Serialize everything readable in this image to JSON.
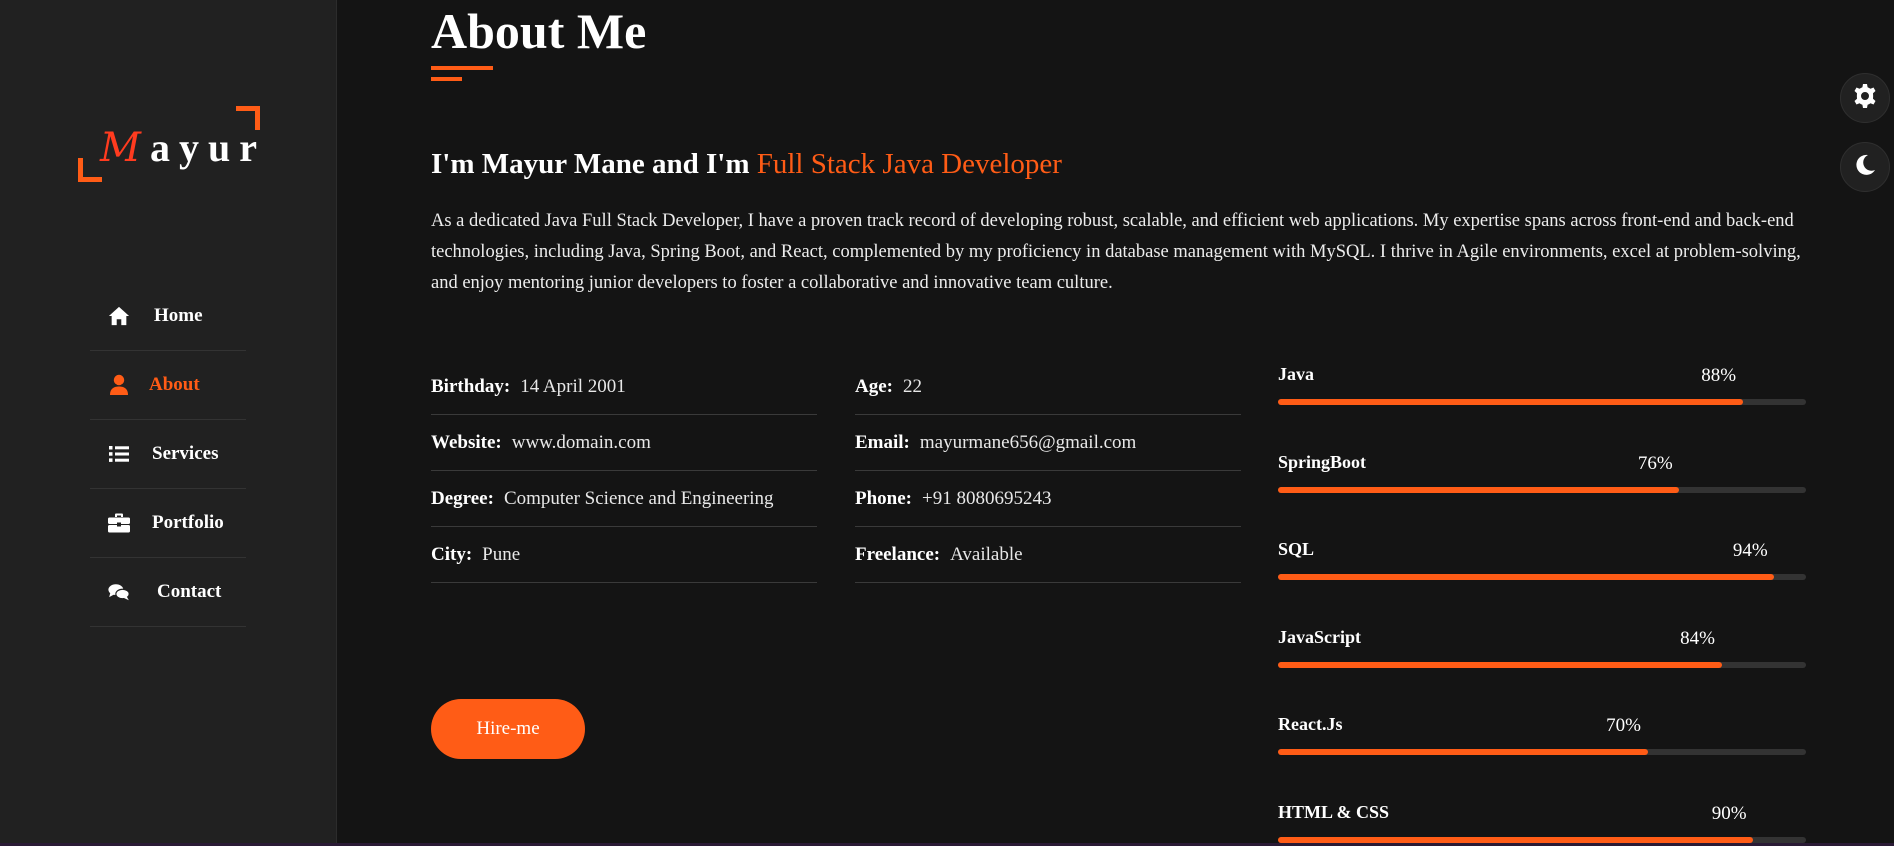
{
  "sidebar": {
    "logo_initial": "M",
    "logo_rest": "ayur",
    "items": [
      {
        "label": "Home",
        "icon": "home-icon",
        "active": false
      },
      {
        "label": "About",
        "icon": "user-icon",
        "active": true
      },
      {
        "label": "Services",
        "icon": "list-icon",
        "active": false
      },
      {
        "label": "Portfolio",
        "icon": "briefcase-icon",
        "active": false
      },
      {
        "label": "Contact",
        "icon": "chat-icon",
        "active": false
      }
    ]
  },
  "about": {
    "title": "About Me",
    "headline_prefix": "I'm Mayur Mane and I'm ",
    "headline_role": "Full Stack Java Developer",
    "intro": "As a dedicated Java Full Stack Developer, I have a proven track record of developing robust, scalable, and efficient web applications. My expertise spans across front-end and back-end technologies, including Java, Spring Boot, and React, complemented by my proficiency in database management with MySQL. I thrive in Agile environments, excel at problem-solving, and enjoy mentoring junior developers to foster a collaborative and innovative team culture.",
    "info_left": [
      {
        "key": "Birthday:",
        "value": "14 April 2001"
      },
      {
        "key": "Website:",
        "value": "www.domain.com"
      },
      {
        "key": "Degree:",
        "value": "Computer Science and Engineering"
      },
      {
        "key": "City:",
        "value": "Pune"
      }
    ],
    "info_right": [
      {
        "key": "Age:",
        "value": "22"
      },
      {
        "key": "Email:",
        "value": "mayurmane656@gmail.com"
      },
      {
        "key": "Phone:",
        "value": "+91 8080695243"
      },
      {
        "key": "Freelance:",
        "value": "Available"
      }
    ],
    "hire_label": "Hire-me",
    "skills": [
      {
        "name": "Java",
        "percent_label": "88%",
        "level": 0.88
      },
      {
        "name": "SpringBoot",
        "percent_label": "76%",
        "level": 0.76
      },
      {
        "name": "SQL",
        "percent_label": "94%",
        "level": 0.94
      },
      {
        "name": "JavaScript",
        "percent_label": "84%",
        "level": 0.84
      },
      {
        "name": "React.Js",
        "percent_label": "70%",
        "level": 0.7
      },
      {
        "name": "HTML & CSS",
        "percent_label": "90%",
        "level": 0.9
      }
    ]
  },
  "floating": {
    "settings_icon": "gear-icon",
    "theme_icon": "moon-icon"
  },
  "colors": {
    "accent": "#ff5c16",
    "background": "#141414",
    "sidebar": "#212121"
  }
}
